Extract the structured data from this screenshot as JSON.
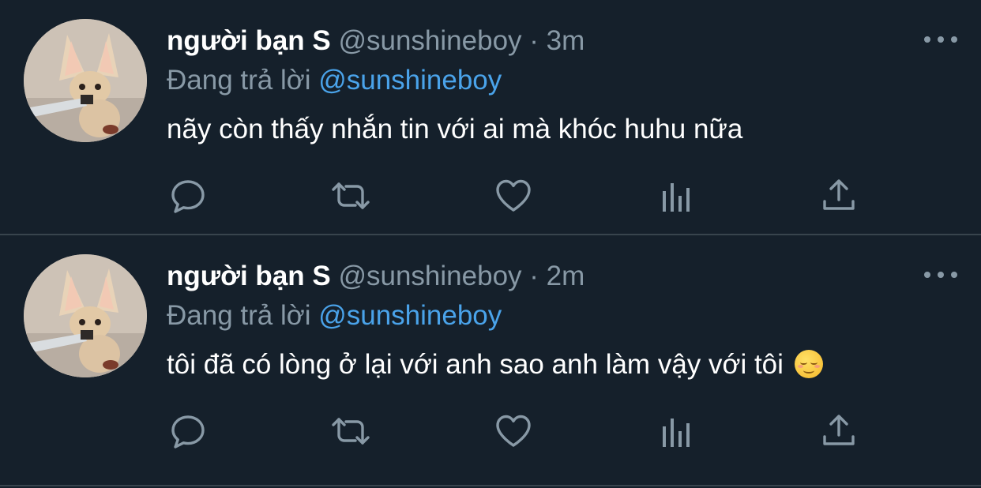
{
  "colors": {
    "background": "#15202b",
    "divider": "#38444d",
    "muted": "#8899a6",
    "accent": "#4aa3ea"
  },
  "tweets": [
    {
      "name": "người bạn S",
      "handle": "@sunshineboy",
      "separator": "·",
      "time": "3m",
      "replying_prefix": "Đang trả lời",
      "replying_to": "@sunshineboy",
      "text": "nãy còn thấy nhắn tin với ai mà khóc huhu nữa",
      "icons": [
        "reply-icon",
        "retweet-icon",
        "like-icon",
        "analytics-icon",
        "share-icon",
        "more-icon"
      ]
    },
    {
      "name": "người bạn S",
      "handle": "@sunshineboy",
      "separator": "·",
      "time": "2m",
      "replying_prefix": "Đang trả lời",
      "replying_to": "@sunshineboy",
      "text": "tôi đã có lòng ở lại với anh sao anh làm vậy với tôi",
      "emoji": "smiling-face-icon",
      "icons": [
        "reply-icon",
        "retweet-icon",
        "like-icon",
        "analytics-icon",
        "share-icon",
        "more-icon"
      ]
    }
  ]
}
